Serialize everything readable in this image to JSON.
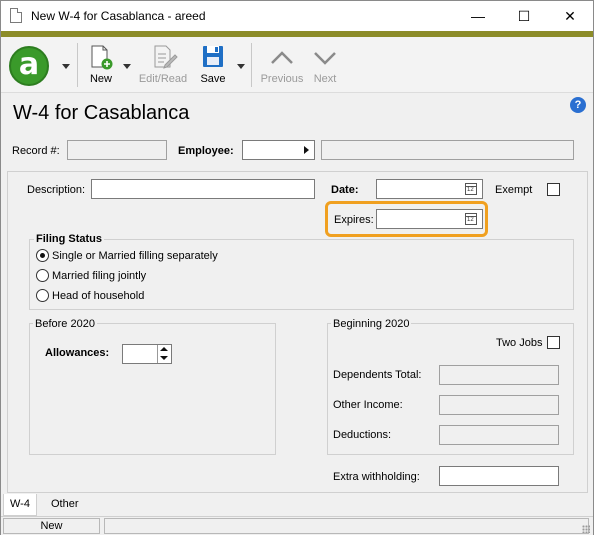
{
  "window": {
    "title": "New W-4 for Casablanca - areed",
    "minimize": "—",
    "maximize": "☐",
    "close": "✕"
  },
  "toolbar": {
    "new_label": "New",
    "edit_label": "Edit/Read",
    "save_label": "Save",
    "previous_label": "Previous",
    "next_label": "Next"
  },
  "header": {
    "title": "W-4 for Casablanca",
    "help": "?"
  },
  "record": {
    "label": "Record #:",
    "value": ""
  },
  "employee": {
    "label": "Employee:",
    "value": "",
    "name_value": ""
  },
  "form": {
    "description_label": "Description:",
    "description_value": "",
    "date_label": "Date:",
    "date_value": "",
    "exempt_label": "Exempt",
    "expires_label": "Expires:",
    "expires_value": ""
  },
  "filing_status": {
    "title": "Filing Status",
    "options": [
      "Single or Married filling separately",
      "Married filing jointly",
      "Head of household"
    ],
    "selected_index": 0
  },
  "before_2020": {
    "title": "Before 2020",
    "allowances_label": "Allowances:",
    "allowances_value": ""
  },
  "beginning_2020": {
    "title": "Beginning 2020",
    "two_jobs_label": "Two Jobs",
    "dependents_label": "Dependents Total:",
    "other_income_label": "Other Income:",
    "deductions_label": "Deductions:",
    "extra_label": "Extra withholding:"
  },
  "tabs": [
    "W-4",
    "Other"
  ],
  "status": {
    "mode": "New"
  },
  "colors": {
    "accent": "#8c8c28",
    "highlight": "#f0a020",
    "logo": "#3a9a2a",
    "help": "#2a6fd1"
  }
}
